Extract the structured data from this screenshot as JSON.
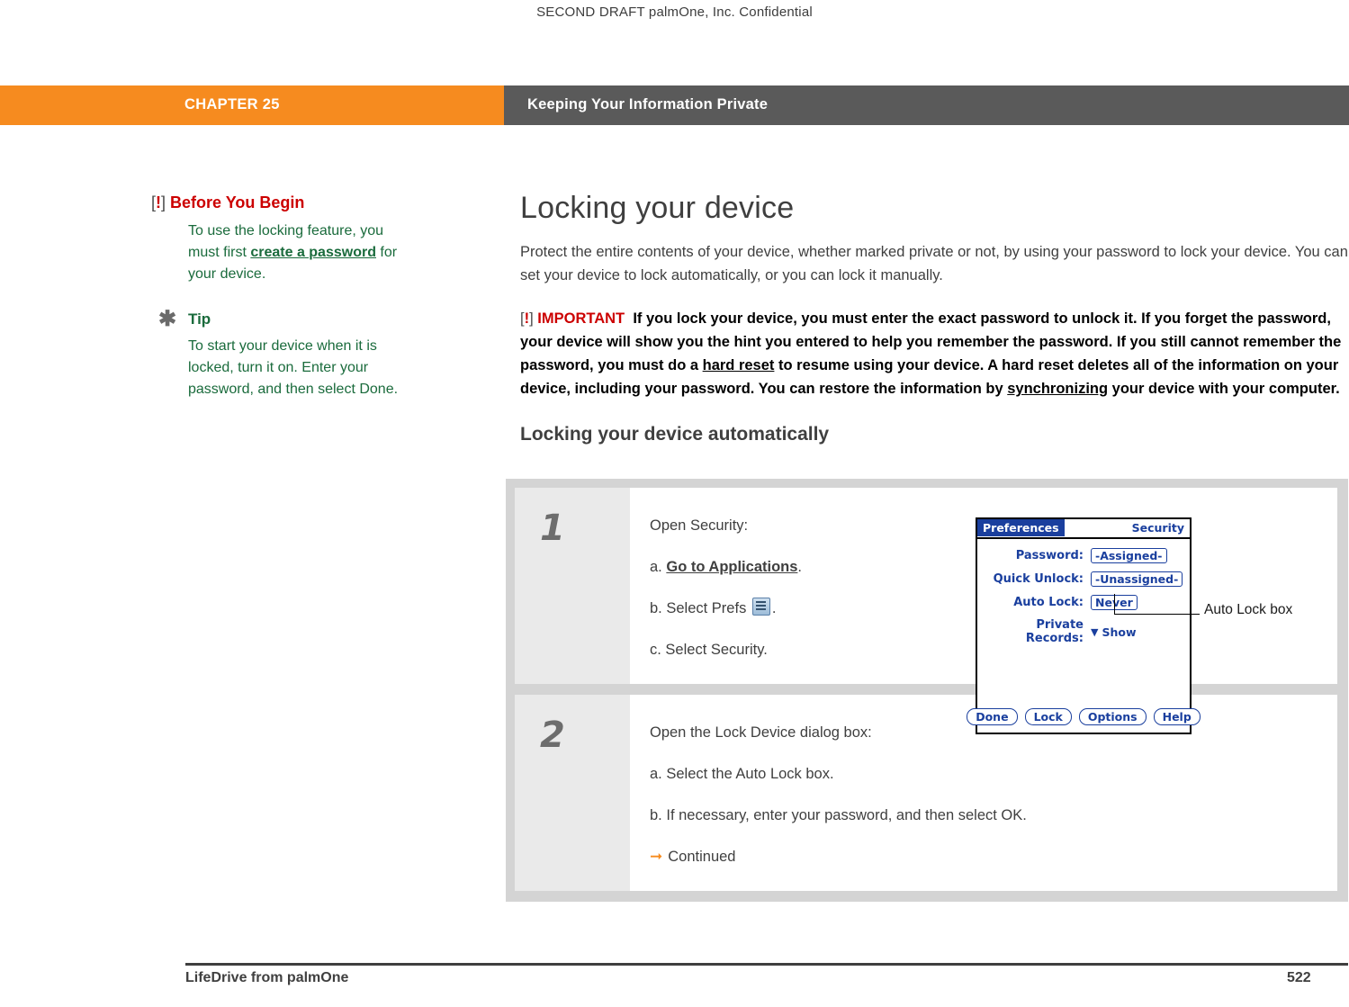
{
  "draft_header": "SECOND DRAFT palmOne, Inc.  Confidential",
  "chapter": {
    "label": "CHAPTER 25",
    "title": "Keeping Your Information Private"
  },
  "sidebar": {
    "before_you_begin": {
      "heading": "Before You Begin",
      "text_1": "To use the locking feature, you must first ",
      "link": "create a password",
      "text_2": " for your device."
    },
    "tip": {
      "heading": "Tip",
      "text": "To start your device when it is locked, turn it on. Enter your password, and then select Done."
    }
  },
  "main": {
    "title": "Locking your device",
    "intro": "Protect the entire contents of your device, whether marked private or not, by using your password to lock your device. You can set your device to lock automatically, or you can lock it manually.",
    "important": {
      "tag": "IMPORTANT",
      "text_1": "If you lock your device, you must enter the exact password to unlock it. If you forget the password, your device will show you the hint you entered to help you remember the password. If you still cannot remember the password, you must do a ",
      "link_1": "hard reset",
      "text_2": " to resume using your device. A hard reset deletes all of the information on your device, including your password. You can restore the information by ",
      "link_2": "synchronizing",
      "text_3": " your device with your computer."
    },
    "subtitle": "Locking your device automatically"
  },
  "steps": [
    {
      "number": "1",
      "lines": [
        {
          "text": "Open Security:"
        },
        {
          "prefix": "a.  ",
          "link": "Go to Applications",
          "suffix": "."
        },
        {
          "prefix": "b.  ",
          "text": "Select Prefs ",
          "icon": "prefs-icon",
          "suffix": "."
        },
        {
          "prefix": "c.  ",
          "text": "Select Security."
        }
      ]
    },
    {
      "number": "2",
      "lines": [
        {
          "text": "Open the Lock Device dialog box:"
        },
        {
          "prefix": "a.  ",
          "text": "Select the Auto Lock box."
        },
        {
          "prefix": "b.  ",
          "text": "If necessary, enter your password, and then select OK."
        },
        {
          "continued": "Continued"
        }
      ]
    }
  ],
  "palm_screen": {
    "app_title": "Preferences",
    "panel_title": "Security",
    "rows": [
      {
        "label": "Password:",
        "value": "-Assigned-"
      },
      {
        "label": "Quick Unlock:",
        "value": "-Unassigned-"
      },
      {
        "label": "Auto Lock:",
        "value": "Never"
      },
      {
        "label": "Private Records:",
        "value": "Show",
        "dropdown": true
      }
    ],
    "buttons": [
      "Done",
      "Lock",
      "Options",
      "Help"
    ],
    "callout": "Auto Lock box"
  },
  "footer": {
    "product": "LifeDrive from palmOne",
    "page": "522"
  },
  "colors": {
    "orange": "#f68b1f",
    "grey_bar": "#5a5a5a",
    "red": "#cc0000",
    "green": "#1a6b3c",
    "palm_blue": "#1a3f9e"
  }
}
